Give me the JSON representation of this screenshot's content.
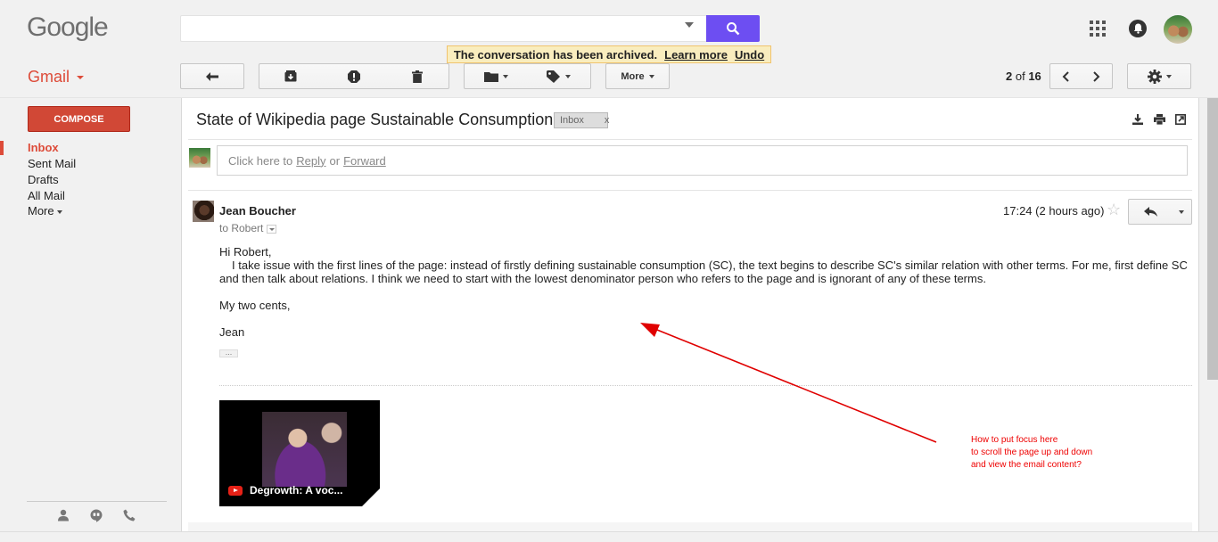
{
  "header": {
    "logo": "Google",
    "search_value": "",
    "notice": {
      "text": "The conversation has been archived.",
      "learn_more": "Learn more",
      "undo": "Undo"
    },
    "app_label": "Gmail"
  },
  "toolbar": {
    "more_label": "More",
    "pager": {
      "current": "2",
      "of": "of",
      "total": "16"
    }
  },
  "sidebar": {
    "compose_label": "COMPOSE",
    "items": [
      {
        "label": "Inbox",
        "active": true
      },
      {
        "label": "Sent Mail"
      },
      {
        "label": "Drafts"
      },
      {
        "label": "All Mail"
      },
      {
        "label": "More"
      }
    ]
  },
  "thread": {
    "subject": "State of Wikipedia page Sustainable Consumption",
    "label": "Inbox",
    "label_remove": "x",
    "reply_prompt": {
      "prefix": "Click here to",
      "reply": "Reply",
      "or": "or",
      "forward": "Forward"
    },
    "message": {
      "sender": "Jean Boucher",
      "to": "to Robert",
      "timestamp": "17:24 (2 hours ago)",
      "greeting": "Hi Robert,",
      "paragraph": "I take issue with the first lines of the page: instead of firstly defining sustainable consumption (SC), the text begins to describe SC's similar relation with other terms. For me, first define SC and then talk about relations. I think we need to start with the lowest denominator person who refers to the page and is ignorant of any of these terms.",
      "closing": "My two cents,",
      "signature": "Jean",
      "ellipsis": "...",
      "video_title": "Degrowth: A voc..."
    }
  },
  "annotation": {
    "text": "How to put focus here\nto scroll the page up and down\nand view the email content?",
    "color": "#e00000"
  },
  "colors": {
    "search_button": "#6d4ef2",
    "compose": "#d14836",
    "accent_red": "#dd4b39",
    "notice_bg": "#f9edbe"
  }
}
